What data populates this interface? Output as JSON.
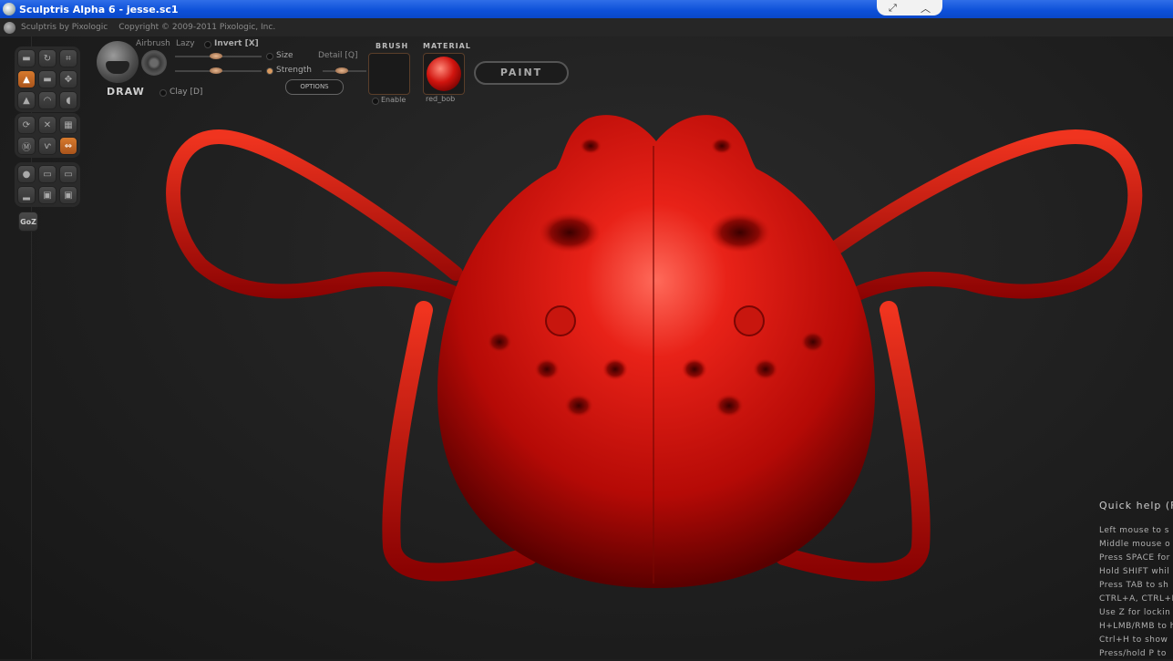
{
  "window": {
    "title": "Sculptris Alpha 6 - jesse.sc1"
  },
  "infobar": {
    "app_name": "Sculptris by Pixologic",
    "copyright": "Copyright © 2009-2011 Pixologic, Inc."
  },
  "brush": {
    "name": "DRAW",
    "airbrush_label": "Airbrush",
    "lazy_label": "Lazy",
    "invert_label": "Invert [X]",
    "size_label": "Size",
    "strength_label": "Strength",
    "detail_label": "Detail [Q]",
    "clay_label": "Clay [D]",
    "options_label": "OPTIONS"
  },
  "brush_slot": {
    "header": "BRUSH",
    "enable_label": "Enable"
  },
  "material_slot": {
    "header": "MATERIAL",
    "name": "red_bob",
    "color": "#d0140e"
  },
  "paint_button": {
    "label": "PAINT"
  },
  "goz_label": "GoZ",
  "quick_help": {
    "title": "Quick help (F",
    "lines": [
      "Left mouse to s",
      "Middle mouse o",
      "Press SPACE for",
      "Hold SHIFT whil",
      "Press TAB to sh",
      "CTRL+A, CTRL+I",
      "Use Z for lockin",
      "H+LMB/RMB to h",
      "Ctrl+H to show",
      "Press/hold P to"
    ]
  },
  "colors": {
    "title_bar": "#0c4fd8",
    "accent_orange": "#d77a2e",
    "model_red": "#d0140e"
  },
  "tool_icons": [
    "draw-icon",
    "rotate-icon",
    "crop-icon",
    "inflate-icon",
    "flatten-icon",
    "move-icon",
    "pinch-icon",
    "smooth-icon",
    "grab-icon",
    "symmetry-icon",
    "wireframe-icon",
    "grid-icon",
    "mask-icon",
    "reduce-icon",
    "mirror-icon",
    "sphere-icon",
    "import-icon",
    "export-icon",
    "plane-icon",
    "save-icon",
    "save-as-icon"
  ]
}
